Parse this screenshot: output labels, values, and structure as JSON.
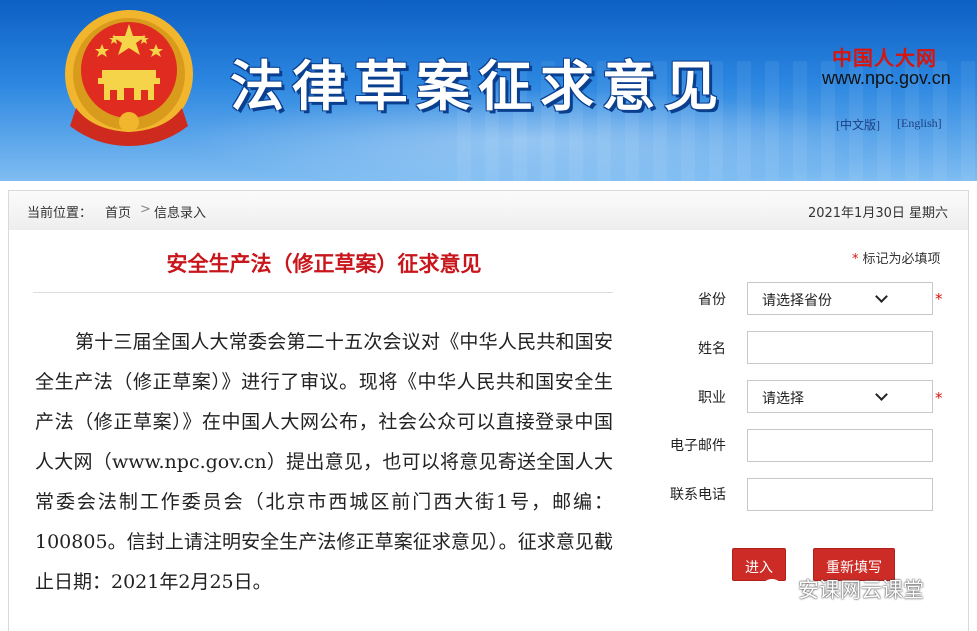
{
  "header": {
    "title": "法律草案征求意见",
    "logo_text": "中国人大网",
    "site_url": "www.npc.gov.cn",
    "lang_zh": "[中文版]",
    "lang_en": "[English]",
    "brand_color": "#d8140e"
  },
  "breadcrumb": {
    "label": "当前位置：",
    "home": "首页",
    "separator": ">",
    "current": "信息录入",
    "date": "2021年1月30日  星期六"
  },
  "article": {
    "title": "安全生产法（修正草案）征求意见",
    "body": "第十三届全国人大常委会第二十五次会议对《中华人民共和国安全生产法（修正草案）》进行了审议。现将《中华人民共和国安全生产法（修正草案）》在中国人大网公布，社会公众可以直接登录中国人大网（www.npc.gov.cn）提出意见，也可以将意见寄送全国人大常委会法制工作委员会（北京市西城区前门西大街1号，邮编：100805。信封上请注明安全生产法修正草案征求意见）。征求意见截止日期：2021年2月25日。"
  },
  "form": {
    "required_star": "*",
    "required_note": "标记为必填项",
    "province": {
      "label": "省份",
      "value": "请选择省份"
    },
    "name": {
      "label": "姓名",
      "value": ""
    },
    "occupation": {
      "label": "职业",
      "value": "请选择"
    },
    "email": {
      "label": "电子邮件",
      "value": ""
    },
    "phone": {
      "label": "联系电话",
      "value": ""
    },
    "submit_label": "进入",
    "reset_label": "重新填写"
  },
  "watermark": {
    "text": "安课网云课堂",
    "icon": "wechat-icon"
  }
}
